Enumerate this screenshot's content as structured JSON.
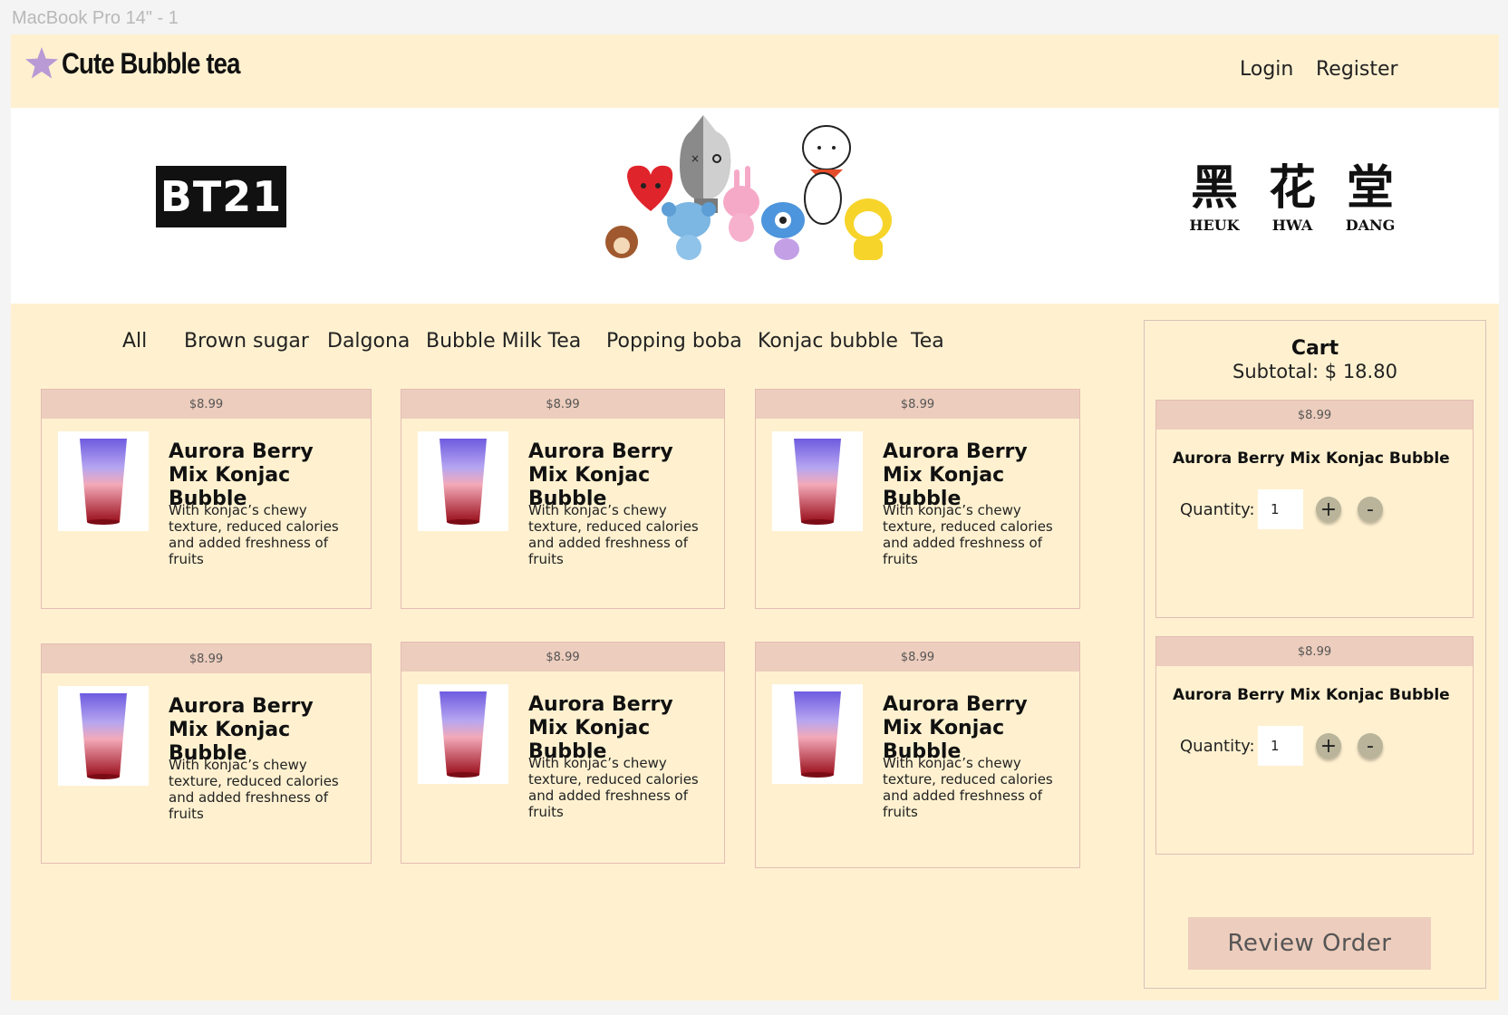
{
  "frame_label": "MacBook Pro 14\" - 1",
  "header": {
    "brand": "Cute Bubble tea",
    "login": "Login",
    "register": "Register"
  },
  "banner": {
    "left_logo": "BT21",
    "right_logo": {
      "chars": [
        "黑",
        "花",
        "堂"
      ],
      "latin": [
        "HEUK",
        "HWA",
        "DANG"
      ]
    }
  },
  "categories": [
    "All",
    "Brown sugar",
    "Dalgona",
    "Bubble Milk Tea",
    "Popping boba",
    "Konjac bubble",
    "Tea"
  ],
  "products": [
    {
      "price": "$8.99",
      "name": "Aurora Berry Mix Konjac Bubble",
      "desc": "With konjac’s chewy texture, reduced calories and added freshness of fruits"
    },
    {
      "price": "$8.99",
      "name": "Aurora Berry Mix Konjac Bubble",
      "desc": "With konjac’s chewy texture, reduced calories and added freshness of fruits"
    },
    {
      "price": "$8.99",
      "name": "Aurora Berry Mix Konjac Bubble",
      "desc": "With konjac’s chewy texture, reduced calories and added freshness of fruits"
    },
    {
      "price": "$8.99",
      "name": "Aurora Berry Mix Konjac Bubble",
      "desc": "With konjac’s chewy texture, reduced calories and added freshness of fruits"
    },
    {
      "price": "$8.99",
      "name": "Aurora Berry Mix Konjac Bubble",
      "desc": "With konjac’s chewy texture, reduced calories and added freshness of fruits"
    },
    {
      "price": "$8.99",
      "name": "Aurora Berry Mix Konjac Bubble",
      "desc": "With konjac’s chewy texture, reduced calories and added freshness of fruits"
    }
  ],
  "cart": {
    "title": "Cart",
    "subtotal": "Subtotal: $ 18.80",
    "items": [
      {
        "price": "$8.99",
        "name": "Aurora Berry Mix Konjac Bubble",
        "qty_label": "Quantity:",
        "qty": "1",
        "plus": "+",
        "minus": "-"
      },
      {
        "price": "$8.99",
        "name": "Aurora Berry Mix Konjac Bubble",
        "qty_label": "Quantity:",
        "qty": "1",
        "plus": "+",
        "minus": "-"
      }
    ],
    "review_button": "Review Order"
  },
  "colors": {
    "page_bg": "#fff1d0",
    "card_header": "#edcdbd",
    "card_border": "#e4bcb4",
    "qty_button": "#b9b49a",
    "star": "#b99ad4"
  }
}
